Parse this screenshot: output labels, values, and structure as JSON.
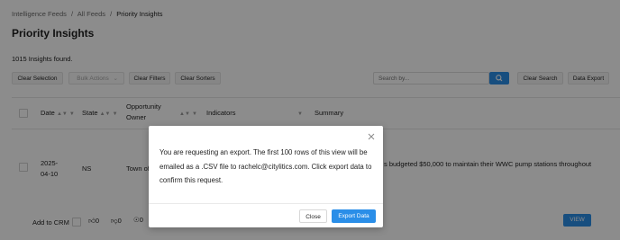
{
  "breadcrumb": [
    "Intelligence Feeds",
    "/",
    "All Feeds",
    "/",
    "Priority Insights"
  ],
  "page_title": "Priority Insights",
  "results_text": "1015 Insights found.",
  "toolbar": {
    "clear_selection": "Clear Selection",
    "bulk_actions": "Bulk Actions",
    "clear_filters": "Clear Filters",
    "clear_sorters": "Clear Sorters",
    "search_placeholder": "Search by...",
    "clear_search": "Clear Search",
    "data_export": "Data Export"
  },
  "table": {
    "columns": [
      "Date",
      "State",
      "Opportunity Owner",
      "Indicators",
      "Summary"
    ],
    "rows": [
      {
        "date_line1": "2025-",
        "date_line2": "04-10",
        "state": "NS",
        "owner": "Town of",
        "summary": "s budgeted $50,000 to maintain their WWC pump stations throughout"
      }
    ]
  },
  "row_footer": {
    "add_to_crm": "Add to CRM",
    "likes": "0",
    "dislikes": "0",
    "other": "0",
    "view": "VIEW"
  },
  "modal": {
    "message": "You are requesting an export. The first 100 rows of this view will be emailed as a .CSV file to rachelc@citylitics.com. Click export data to confirm this request.",
    "close_label": "Close",
    "export_label": "Export Data"
  },
  "colors": {
    "accent": "#2a8ee8",
    "overlay": "rgba(0,0,0,0.45)"
  }
}
